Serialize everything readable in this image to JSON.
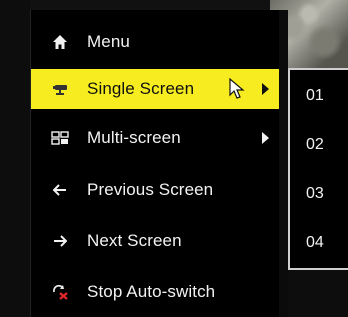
{
  "menu": {
    "items": [
      {
        "label": "Menu",
        "icon": "home-icon",
        "selected": false,
        "has_submenu": false
      },
      {
        "label": "Single Screen",
        "icon": "camera-icon",
        "selected": true,
        "has_submenu": true
      },
      {
        "label": "Multi-screen",
        "icon": "multi-screen-icon",
        "selected": false,
        "has_submenu": true
      },
      {
        "label": "Previous Screen",
        "icon": "arrow-left-icon",
        "selected": false,
        "has_submenu": false
      },
      {
        "label": "Next Screen",
        "icon": "arrow-right-icon",
        "selected": false,
        "has_submenu": false
      },
      {
        "label": "Stop Auto-switch",
        "icon": "stop-auto-switch-icon",
        "selected": false,
        "has_submenu": false
      }
    ]
  },
  "submenu": {
    "items": [
      {
        "label": "01"
      },
      {
        "label": "02"
      },
      {
        "label": "03"
      },
      {
        "label": "04"
      }
    ]
  },
  "colors": {
    "menu_background": "#000000",
    "selected_background": "#f6ec1f",
    "text": "#f2f2f2",
    "selected_text": "#111111",
    "submenu_border": "#cfcfcf",
    "stop_icon_red": "#e0282a"
  }
}
